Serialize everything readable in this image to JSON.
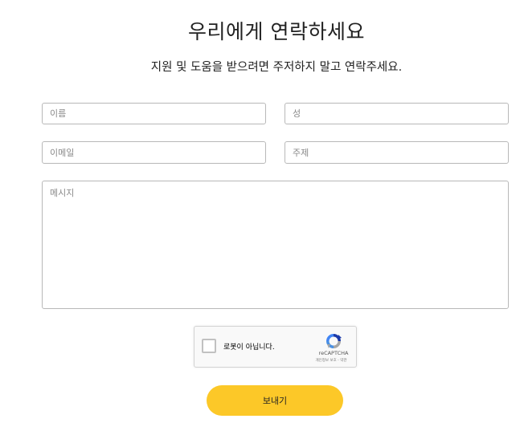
{
  "heading": {
    "title": "우리에게 연락하세요",
    "subtitle": "지원 및 도움을 받으려면 주저하지 말고 연락주세요."
  },
  "form": {
    "first_name_placeholder": "이름",
    "last_name_placeholder": "성",
    "email_placeholder": "이메일",
    "subject_placeholder": "주제",
    "message_placeholder": "메시지",
    "submit_label": "보내기"
  },
  "recaptcha": {
    "checkbox_label": "로봇이 아닙니다.",
    "brand": "reCAPTCHA",
    "terms": "개인정보 보호 - 약관"
  },
  "colors": {
    "accent": "#fcc828",
    "text": "#222222",
    "field_border": "#b8b8b8"
  }
}
